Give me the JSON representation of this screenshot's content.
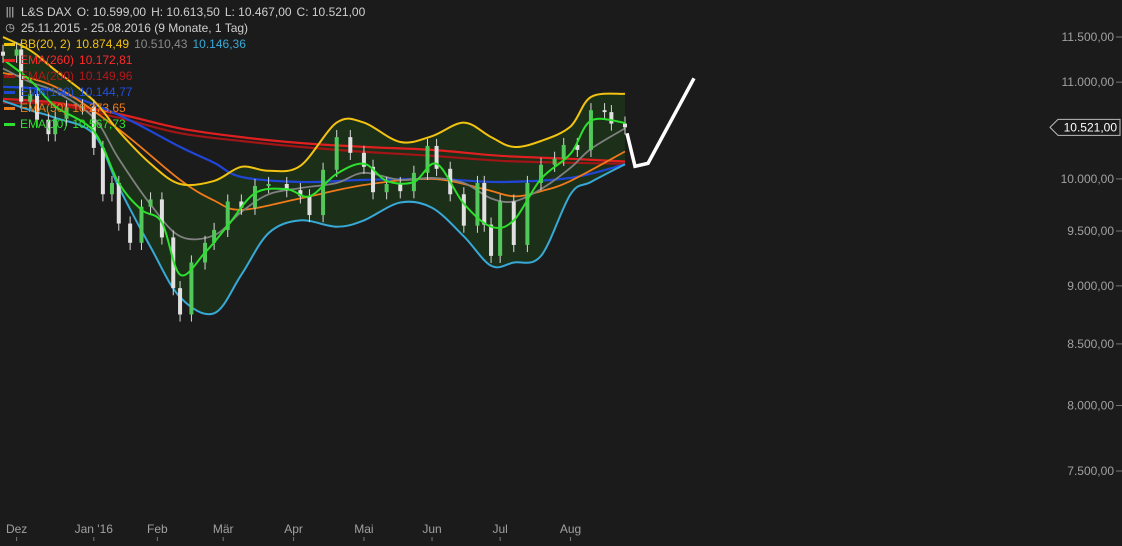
{
  "header": {
    "symbol": "L&S DAX",
    "open": "O: 10.599,00",
    "high": "H: 10.613,50",
    "low": "L: 10.467,00",
    "close": "C: 10.521,00",
    "period": "25.11.2015 - 25.08.2016 (9 Monate, 1 Tag)"
  },
  "legend": [
    {
      "label": "BB(20, 2)",
      "values": [
        "10.874,49",
        "10.510,43",
        "10.146,36"
      ],
      "colors": [
        "#f2c311",
        "#8a8a8a",
        "#38a9d6"
      ],
      "swatch": "#f2c311"
    },
    {
      "label": "EMA(260)",
      "values": [
        "10.172,81"
      ],
      "colors": [
        "#ff2a2a"
      ],
      "swatch": "#e02020"
    },
    {
      "label": "EMA(200)",
      "values": [
        "10.149,96"
      ],
      "colors": [
        "#b01a1a"
      ],
      "swatch": "#a01515"
    },
    {
      "label": "EMA(100)",
      "values": [
        "10.144,77"
      ],
      "colors": [
        "#2050e0"
      ],
      "swatch": "#1f46d6"
    },
    {
      "label": "EMA(50)",
      "values": [
        "10.273,65"
      ],
      "colors": [
        "#f07a1a"
      ],
      "swatch": "#f07a1a"
    },
    {
      "label": "EMA(10)",
      "values": [
        "10.567,73"
      ],
      "colors": [
        "#2de02d"
      ],
      "swatch": "#2de02d"
    }
  ],
  "colors": {
    "background": "#1b1b1b",
    "axis_text": "#a0a0a0",
    "band_fill": "#1c3019",
    "candle_up": "#53c85a",
    "candle_down": "#e0e0e0",
    "wick": "#d8d8d8"
  },
  "chart_data": {
    "type": "candlestick",
    "yaxis": {
      "ticks": [
        11500,
        11000,
        10000,
        9500,
        9000,
        8500,
        8000,
        7500
      ],
      "tick_labels": [
        "11.500,00",
        "11.000,00",
        "10.000,00",
        "9.500,00",
        "9.000,00",
        "8.500,00",
        "8.000,00",
        "7.500,00"
      ],
      "last_price_label": "10.521,00",
      "last_price": 10521,
      "scale": "log",
      "position": "right"
    },
    "xaxis": {
      "labels": [
        "Dez",
        "Jan '16",
        "Feb",
        "Mär",
        "Apr",
        "Mai",
        "Jun",
        "Jul",
        "Aug"
      ],
      "label_dates": [
        "2015-12-01",
        "2016-01-04",
        "2016-02-01",
        "2016-03-01",
        "2016-04-01",
        "2016-05-02",
        "2016-06-01",
        "2016-07-01",
        "2016-08-01"
      ],
      "range": [
        "2015-11-25",
        "2016-08-25"
      ]
    },
    "series": {
      "close": {
        "dates": [
          "2015-11-25",
          "2015-12-01",
          "2015-12-03",
          "2015-12-07",
          "2015-12-10",
          "2015-12-15",
          "2015-12-18",
          "2015-12-23",
          "2015-12-30",
          "2016-01-04",
          "2016-01-08",
          "2016-01-12",
          "2016-01-15",
          "2016-01-20",
          "2016-01-25",
          "2016-01-29",
          "2016-02-03",
          "2016-02-08",
          "2016-02-11",
          "2016-02-16",
          "2016-02-22",
          "2016-02-26",
          "2016-03-03",
          "2016-03-09",
          "2016-03-15",
          "2016-03-21",
          "2016-03-29",
          "2016-04-04",
          "2016-04-08",
          "2016-04-14",
          "2016-04-20",
          "2016-04-26",
          "2016-05-02",
          "2016-05-06",
          "2016-05-12",
          "2016-05-18",
          "2016-05-24",
          "2016-05-30",
          "2016-06-03",
          "2016-06-09",
          "2016-06-15",
          "2016-06-21",
          "2016-06-24",
          "2016-06-27",
          "2016-07-01",
          "2016-07-07",
          "2016-07-13",
          "2016-07-19",
          "2016-07-25",
          "2016-07-29",
          "2016-08-04",
          "2016-08-10",
          "2016-08-16",
          "2016-08-19",
          "2016-08-25"
        ],
        "values": [
          11290,
          11360,
          10790,
          10870,
          10600,
          10450,
          10610,
          10730,
          10740,
          10310,
          9850,
          9960,
          9570,
          9390,
          9730,
          9800,
          9440,
          8980,
          8750,
          9210,
          9390,
          9510,
          9780,
          9720,
          9930,
          9950,
          9890,
          9830,
          9650,
          10090,
          10420,
          10260,
          10120,
          9870,
          9950,
          9880,
          10060,
          10330,
          10100,
          9850,
          9550,
          9960,
          9560,
          9270,
          9780,
          9370,
          9960,
          10140,
          10200,
          10340,
          10290,
          10700,
          10680,
          10560,
          10521
        ]
      },
      "bb_upper": {
        "dates": [
          "2015-11-25",
          "2015-12-07",
          "2015-12-18",
          "2016-01-04",
          "2016-01-15",
          "2016-01-29",
          "2016-02-11",
          "2016-02-26",
          "2016-03-09",
          "2016-03-21",
          "2016-04-04",
          "2016-04-20",
          "2016-05-02",
          "2016-05-18",
          "2016-06-01",
          "2016-06-15",
          "2016-06-27",
          "2016-07-07",
          "2016-07-19",
          "2016-08-01",
          "2016-08-10",
          "2016-08-25"
        ],
        "values": [
          11500,
          11350,
          11130,
          10800,
          10480,
          10150,
          9950,
          9980,
          10120,
          10080,
          10130,
          10570,
          10570,
          10370,
          10430,
          10570,
          10420,
          10320,
          10380,
          10530,
          10840,
          10874
        ]
      },
      "bb_middle": {
        "dates": [
          "2015-11-25",
          "2015-12-07",
          "2015-12-18",
          "2016-01-04",
          "2016-01-15",
          "2016-01-29",
          "2016-02-11",
          "2016-02-26",
          "2016-03-09",
          "2016-03-21",
          "2016-04-04",
          "2016-04-20",
          "2016-05-02",
          "2016-05-18",
          "2016-06-01",
          "2016-06-15",
          "2016-06-27",
          "2016-07-07",
          "2016-07-19",
          "2016-08-01",
          "2016-08-10",
          "2016-08-25"
        ],
        "values": [
          11150,
          11000,
          10900,
          10620,
          10200,
          9750,
          9450,
          9460,
          9680,
          9850,
          9910,
          9960,
          10060,
          9990,
          10010,
          9960,
          9810,
          9780,
          9900,
          10110,
          10300,
          10510
        ]
      },
      "bb_lower": {
        "dates": [
          "2015-11-25",
          "2015-12-07",
          "2015-12-18",
          "2016-01-04",
          "2016-01-15",
          "2016-01-29",
          "2016-02-11",
          "2016-02-26",
          "2016-03-09",
          "2016-03-21",
          "2016-04-04",
          "2016-04-20",
          "2016-05-02",
          "2016-05-18",
          "2016-06-01",
          "2016-06-15",
          "2016-06-27",
          "2016-07-07",
          "2016-07-19",
          "2016-08-01",
          "2016-08-10",
          "2016-08-25"
        ],
        "values": [
          10800,
          10700,
          10620,
          10450,
          9920,
          9350,
          8900,
          8760,
          9100,
          9480,
          9600,
          9540,
          9600,
          9770,
          9720,
          9450,
          9180,
          9210,
          9270,
          9850,
          9970,
          10146
        ]
      },
      "ema260": {
        "dates": [
          "2015-11-25",
          "2015-12-18",
          "2016-01-15",
          "2016-02-11",
          "2016-03-09",
          "2016-04-04",
          "2016-05-02",
          "2016-06-01",
          "2016-07-01",
          "2016-08-01",
          "2016-08-25"
        ],
        "values": [
          10820,
          10780,
          10660,
          10510,
          10420,
          10360,
          10320,
          10290,
          10230,
          10200,
          10173
        ]
      },
      "ema200": {
        "dates": [
          "2015-11-25",
          "2015-12-18",
          "2016-01-15",
          "2016-02-11",
          "2016-03-09",
          "2016-04-04",
          "2016-05-02",
          "2016-06-01",
          "2016-07-01",
          "2016-08-01",
          "2016-08-25"
        ],
        "values": [
          10780,
          10760,
          10620,
          10460,
          10380,
          10320,
          10270,
          10230,
          10180,
          10160,
          10150
        ]
      },
      "ema100": {
        "dates": [
          "2015-11-25",
          "2015-12-18",
          "2016-01-15",
          "2016-02-11",
          "2016-02-26",
          "2016-03-09",
          "2016-04-04",
          "2016-05-02",
          "2016-06-01",
          "2016-07-01",
          "2016-08-01",
          "2016-08-25"
        ],
        "values": [
          10950,
          10900,
          10650,
          10320,
          10160,
          10020,
          9970,
          9990,
          10000,
          9970,
          10010,
          10145
        ]
      },
      "ema50": {
        "dates": [
          "2015-11-25",
          "2015-12-18",
          "2016-01-15",
          "2016-02-11",
          "2016-02-26",
          "2016-03-09",
          "2016-04-04",
          "2016-05-02",
          "2016-06-01",
          "2016-06-24",
          "2016-07-07",
          "2016-07-19",
          "2016-08-01",
          "2016-08-25"
        ],
        "values": [
          11100,
          10950,
          10500,
          9990,
          9790,
          9700,
          9810,
          9940,
          10000,
          9900,
          9830,
          9880,
          9980,
          10274
        ]
      },
      "ema10": {
        "dates": [
          "2015-11-25",
          "2015-12-07",
          "2015-12-18",
          "2016-01-04",
          "2016-01-15",
          "2016-01-25",
          "2016-02-03",
          "2016-02-11",
          "2016-02-22",
          "2016-03-03",
          "2016-03-15",
          "2016-03-29",
          "2016-04-08",
          "2016-04-20",
          "2016-05-02",
          "2016-05-12",
          "2016-05-24",
          "2016-06-03",
          "2016-06-15",
          "2016-06-27",
          "2016-07-07",
          "2016-07-19",
          "2016-08-01",
          "2016-08-10",
          "2016-08-25"
        ],
        "values": [
          11250,
          11020,
          10740,
          10480,
          9960,
          9700,
          9580,
          9100,
          9300,
          9550,
          9860,
          9900,
          9830,
          10050,
          10150,
          9980,
          9970,
          10150,
          9760,
          9540,
          9600,
          10000,
          10250,
          10590,
          10568
        ]
      }
    }
  }
}
